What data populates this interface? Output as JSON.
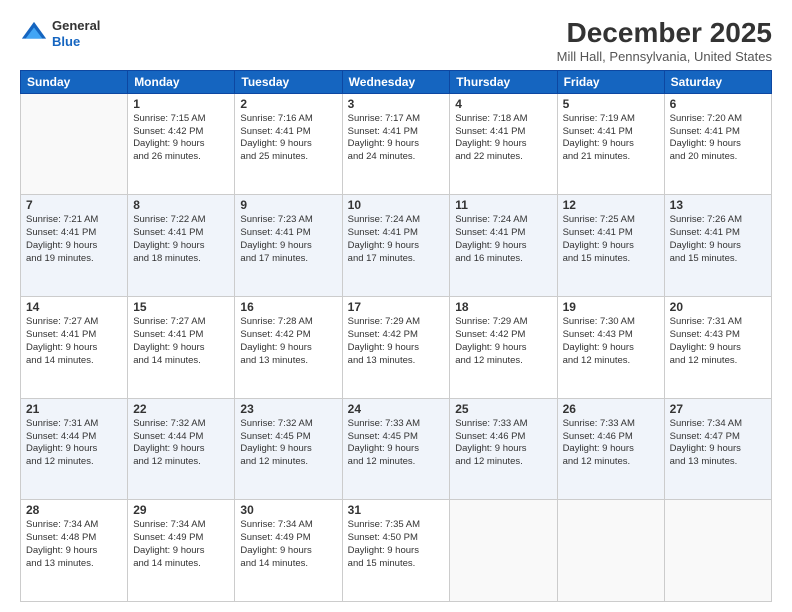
{
  "header": {
    "logo_line1": "General",
    "logo_line2": "Blue",
    "month": "December 2025",
    "location": "Mill Hall, Pennsylvania, United States"
  },
  "days_of_week": [
    "Sunday",
    "Monday",
    "Tuesday",
    "Wednesday",
    "Thursday",
    "Friday",
    "Saturday"
  ],
  "weeks": [
    [
      {
        "day": "",
        "info": ""
      },
      {
        "day": "1",
        "info": "Sunrise: 7:15 AM\nSunset: 4:42 PM\nDaylight: 9 hours\nand 26 minutes."
      },
      {
        "day": "2",
        "info": "Sunrise: 7:16 AM\nSunset: 4:41 PM\nDaylight: 9 hours\nand 25 minutes."
      },
      {
        "day": "3",
        "info": "Sunrise: 7:17 AM\nSunset: 4:41 PM\nDaylight: 9 hours\nand 24 minutes."
      },
      {
        "day": "4",
        "info": "Sunrise: 7:18 AM\nSunset: 4:41 PM\nDaylight: 9 hours\nand 22 minutes."
      },
      {
        "day": "5",
        "info": "Sunrise: 7:19 AM\nSunset: 4:41 PM\nDaylight: 9 hours\nand 21 minutes."
      },
      {
        "day": "6",
        "info": "Sunrise: 7:20 AM\nSunset: 4:41 PM\nDaylight: 9 hours\nand 20 minutes."
      }
    ],
    [
      {
        "day": "7",
        "info": "Sunrise: 7:21 AM\nSunset: 4:41 PM\nDaylight: 9 hours\nand 19 minutes."
      },
      {
        "day": "8",
        "info": "Sunrise: 7:22 AM\nSunset: 4:41 PM\nDaylight: 9 hours\nand 18 minutes."
      },
      {
        "day": "9",
        "info": "Sunrise: 7:23 AM\nSunset: 4:41 PM\nDaylight: 9 hours\nand 17 minutes."
      },
      {
        "day": "10",
        "info": "Sunrise: 7:24 AM\nSunset: 4:41 PM\nDaylight: 9 hours\nand 17 minutes."
      },
      {
        "day": "11",
        "info": "Sunrise: 7:24 AM\nSunset: 4:41 PM\nDaylight: 9 hours\nand 16 minutes."
      },
      {
        "day": "12",
        "info": "Sunrise: 7:25 AM\nSunset: 4:41 PM\nDaylight: 9 hours\nand 15 minutes."
      },
      {
        "day": "13",
        "info": "Sunrise: 7:26 AM\nSunset: 4:41 PM\nDaylight: 9 hours\nand 15 minutes."
      }
    ],
    [
      {
        "day": "14",
        "info": "Sunrise: 7:27 AM\nSunset: 4:41 PM\nDaylight: 9 hours\nand 14 minutes."
      },
      {
        "day": "15",
        "info": "Sunrise: 7:27 AM\nSunset: 4:41 PM\nDaylight: 9 hours\nand 14 minutes."
      },
      {
        "day": "16",
        "info": "Sunrise: 7:28 AM\nSunset: 4:42 PM\nDaylight: 9 hours\nand 13 minutes."
      },
      {
        "day": "17",
        "info": "Sunrise: 7:29 AM\nSunset: 4:42 PM\nDaylight: 9 hours\nand 13 minutes."
      },
      {
        "day": "18",
        "info": "Sunrise: 7:29 AM\nSunset: 4:42 PM\nDaylight: 9 hours\nand 12 minutes."
      },
      {
        "day": "19",
        "info": "Sunrise: 7:30 AM\nSunset: 4:43 PM\nDaylight: 9 hours\nand 12 minutes."
      },
      {
        "day": "20",
        "info": "Sunrise: 7:31 AM\nSunset: 4:43 PM\nDaylight: 9 hours\nand 12 minutes."
      }
    ],
    [
      {
        "day": "21",
        "info": "Sunrise: 7:31 AM\nSunset: 4:44 PM\nDaylight: 9 hours\nand 12 minutes."
      },
      {
        "day": "22",
        "info": "Sunrise: 7:32 AM\nSunset: 4:44 PM\nDaylight: 9 hours\nand 12 minutes."
      },
      {
        "day": "23",
        "info": "Sunrise: 7:32 AM\nSunset: 4:45 PM\nDaylight: 9 hours\nand 12 minutes."
      },
      {
        "day": "24",
        "info": "Sunrise: 7:33 AM\nSunset: 4:45 PM\nDaylight: 9 hours\nand 12 minutes."
      },
      {
        "day": "25",
        "info": "Sunrise: 7:33 AM\nSunset: 4:46 PM\nDaylight: 9 hours\nand 12 minutes."
      },
      {
        "day": "26",
        "info": "Sunrise: 7:33 AM\nSunset: 4:46 PM\nDaylight: 9 hours\nand 12 minutes."
      },
      {
        "day": "27",
        "info": "Sunrise: 7:34 AM\nSunset: 4:47 PM\nDaylight: 9 hours\nand 13 minutes."
      }
    ],
    [
      {
        "day": "28",
        "info": "Sunrise: 7:34 AM\nSunset: 4:48 PM\nDaylight: 9 hours\nand 13 minutes."
      },
      {
        "day": "29",
        "info": "Sunrise: 7:34 AM\nSunset: 4:49 PM\nDaylight: 9 hours\nand 14 minutes."
      },
      {
        "day": "30",
        "info": "Sunrise: 7:34 AM\nSunset: 4:49 PM\nDaylight: 9 hours\nand 14 minutes."
      },
      {
        "day": "31",
        "info": "Sunrise: 7:35 AM\nSunset: 4:50 PM\nDaylight: 9 hours\nand 15 minutes."
      },
      {
        "day": "",
        "info": ""
      },
      {
        "day": "",
        "info": ""
      },
      {
        "day": "",
        "info": ""
      }
    ]
  ]
}
